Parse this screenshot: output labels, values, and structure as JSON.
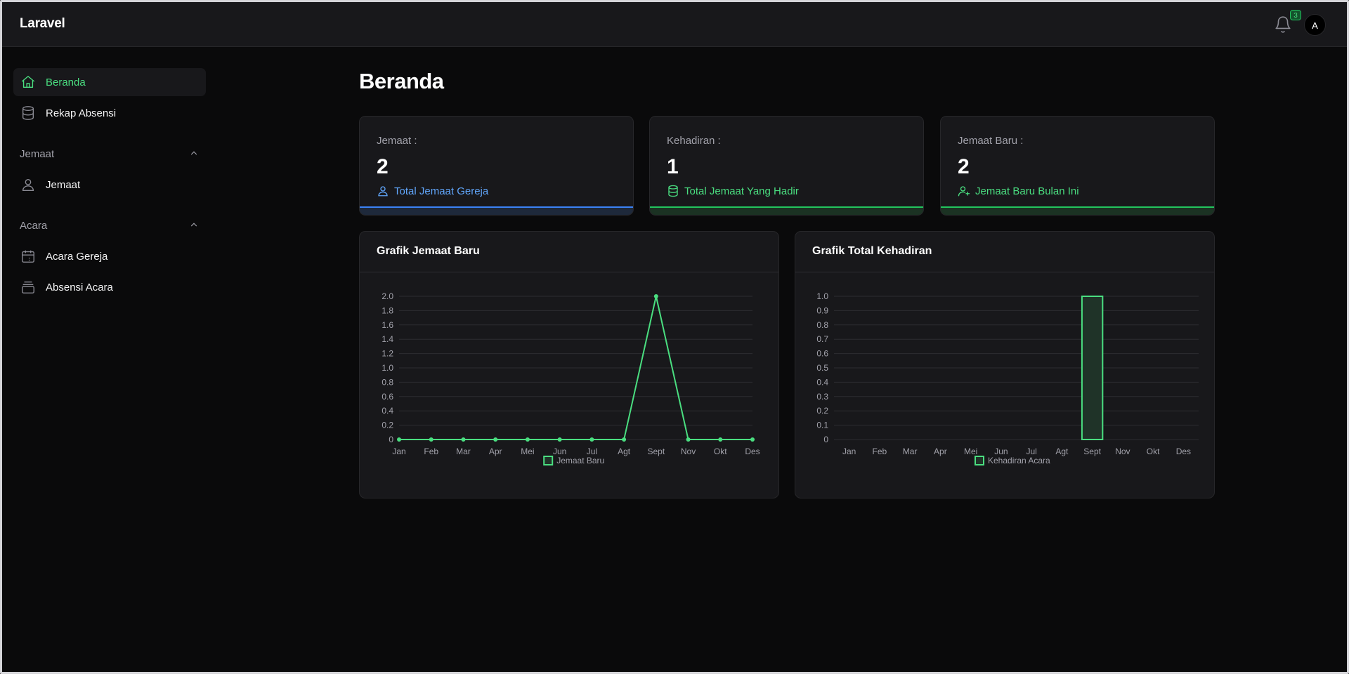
{
  "app": {
    "brand": "Laravel",
    "notification_count": "3",
    "avatar_initial": "A"
  },
  "sidebar": {
    "items": [
      {
        "label": "Beranda",
        "icon": "home-icon",
        "active": true
      },
      {
        "label": "Rekap Absensi",
        "icon": "database-icon",
        "active": false
      }
    ],
    "groups": [
      {
        "title": "Jemaat",
        "items": [
          {
            "label": "Jemaat",
            "icon": "user-icon"
          }
        ]
      },
      {
        "title": "Acara",
        "items": [
          {
            "label": "Acara Gereja",
            "icon": "calendar-icon"
          },
          {
            "label": "Absensi Acara",
            "icon": "archive-icon"
          }
        ]
      }
    ]
  },
  "page": {
    "title": "Beranda"
  },
  "stats": [
    {
      "label": "Jemaat :",
      "value": "2",
      "subtext": "Total Jemaat Gereja",
      "icon": "user-icon",
      "color": "#3b82f6"
    },
    {
      "label": "Kehadiran :",
      "value": "1",
      "subtext": "Total Jemaat Yang Hadir",
      "icon": "database-icon",
      "color": "#22c55e"
    },
    {
      "label": "Jemaat Baru :",
      "value": "2",
      "subtext": "Jemaat Baru Bulan Ini",
      "icon": "user-plus-icon",
      "color": "#22c55e"
    }
  ],
  "charts": {
    "left_title": "Grafik Jemaat Baru",
    "right_title": "Grafik Total Kehadiran"
  },
  "colors": {
    "accent": "#4ade80",
    "blue": "#3b82f6",
    "background": "#0a0a0b",
    "card": "#18181b"
  },
  "chart_data": [
    {
      "type": "line",
      "title": "Grafik Jemaat Baru",
      "categories": [
        "Jan",
        "Feb",
        "Mar",
        "Apr",
        "Mei",
        "Jun",
        "Jul",
        "Agt",
        "Sept",
        "Nov",
        "Okt",
        "Des"
      ],
      "series": [
        {
          "name": "Jemaat Baru",
          "values": [
            0,
            0,
            0,
            0,
            0,
            0,
            0,
            0,
            2,
            0,
            0,
            0
          ],
          "color": "#4ade80"
        }
      ],
      "ylim": [
        0,
        2
      ],
      "yticks": [
        "0",
        "0.2",
        "0.4",
        "0.6",
        "0.8",
        "1.0",
        "1.2",
        "1.4",
        "1.6",
        "1.8",
        "2.0"
      ],
      "grid": true,
      "legend": "bottom"
    },
    {
      "type": "bar",
      "title": "Grafik Total Kehadiran",
      "categories": [
        "Jan",
        "Feb",
        "Mar",
        "Apr",
        "Mei",
        "Jun",
        "Jul",
        "Agt",
        "Sept",
        "Nov",
        "Okt",
        "Des"
      ],
      "series": [
        {
          "name": "Kehadiran Acara",
          "values": [
            0,
            0,
            0,
            0,
            0,
            0,
            0,
            0,
            1,
            0,
            0,
            0
          ],
          "color": "#4ade80"
        }
      ],
      "ylim": [
        0,
        1
      ],
      "yticks": [
        "0",
        "0.1",
        "0.2",
        "0.3",
        "0.4",
        "0.5",
        "0.6",
        "0.7",
        "0.8",
        "0.9",
        "1.0"
      ],
      "grid": true,
      "legend": "bottom"
    }
  ]
}
